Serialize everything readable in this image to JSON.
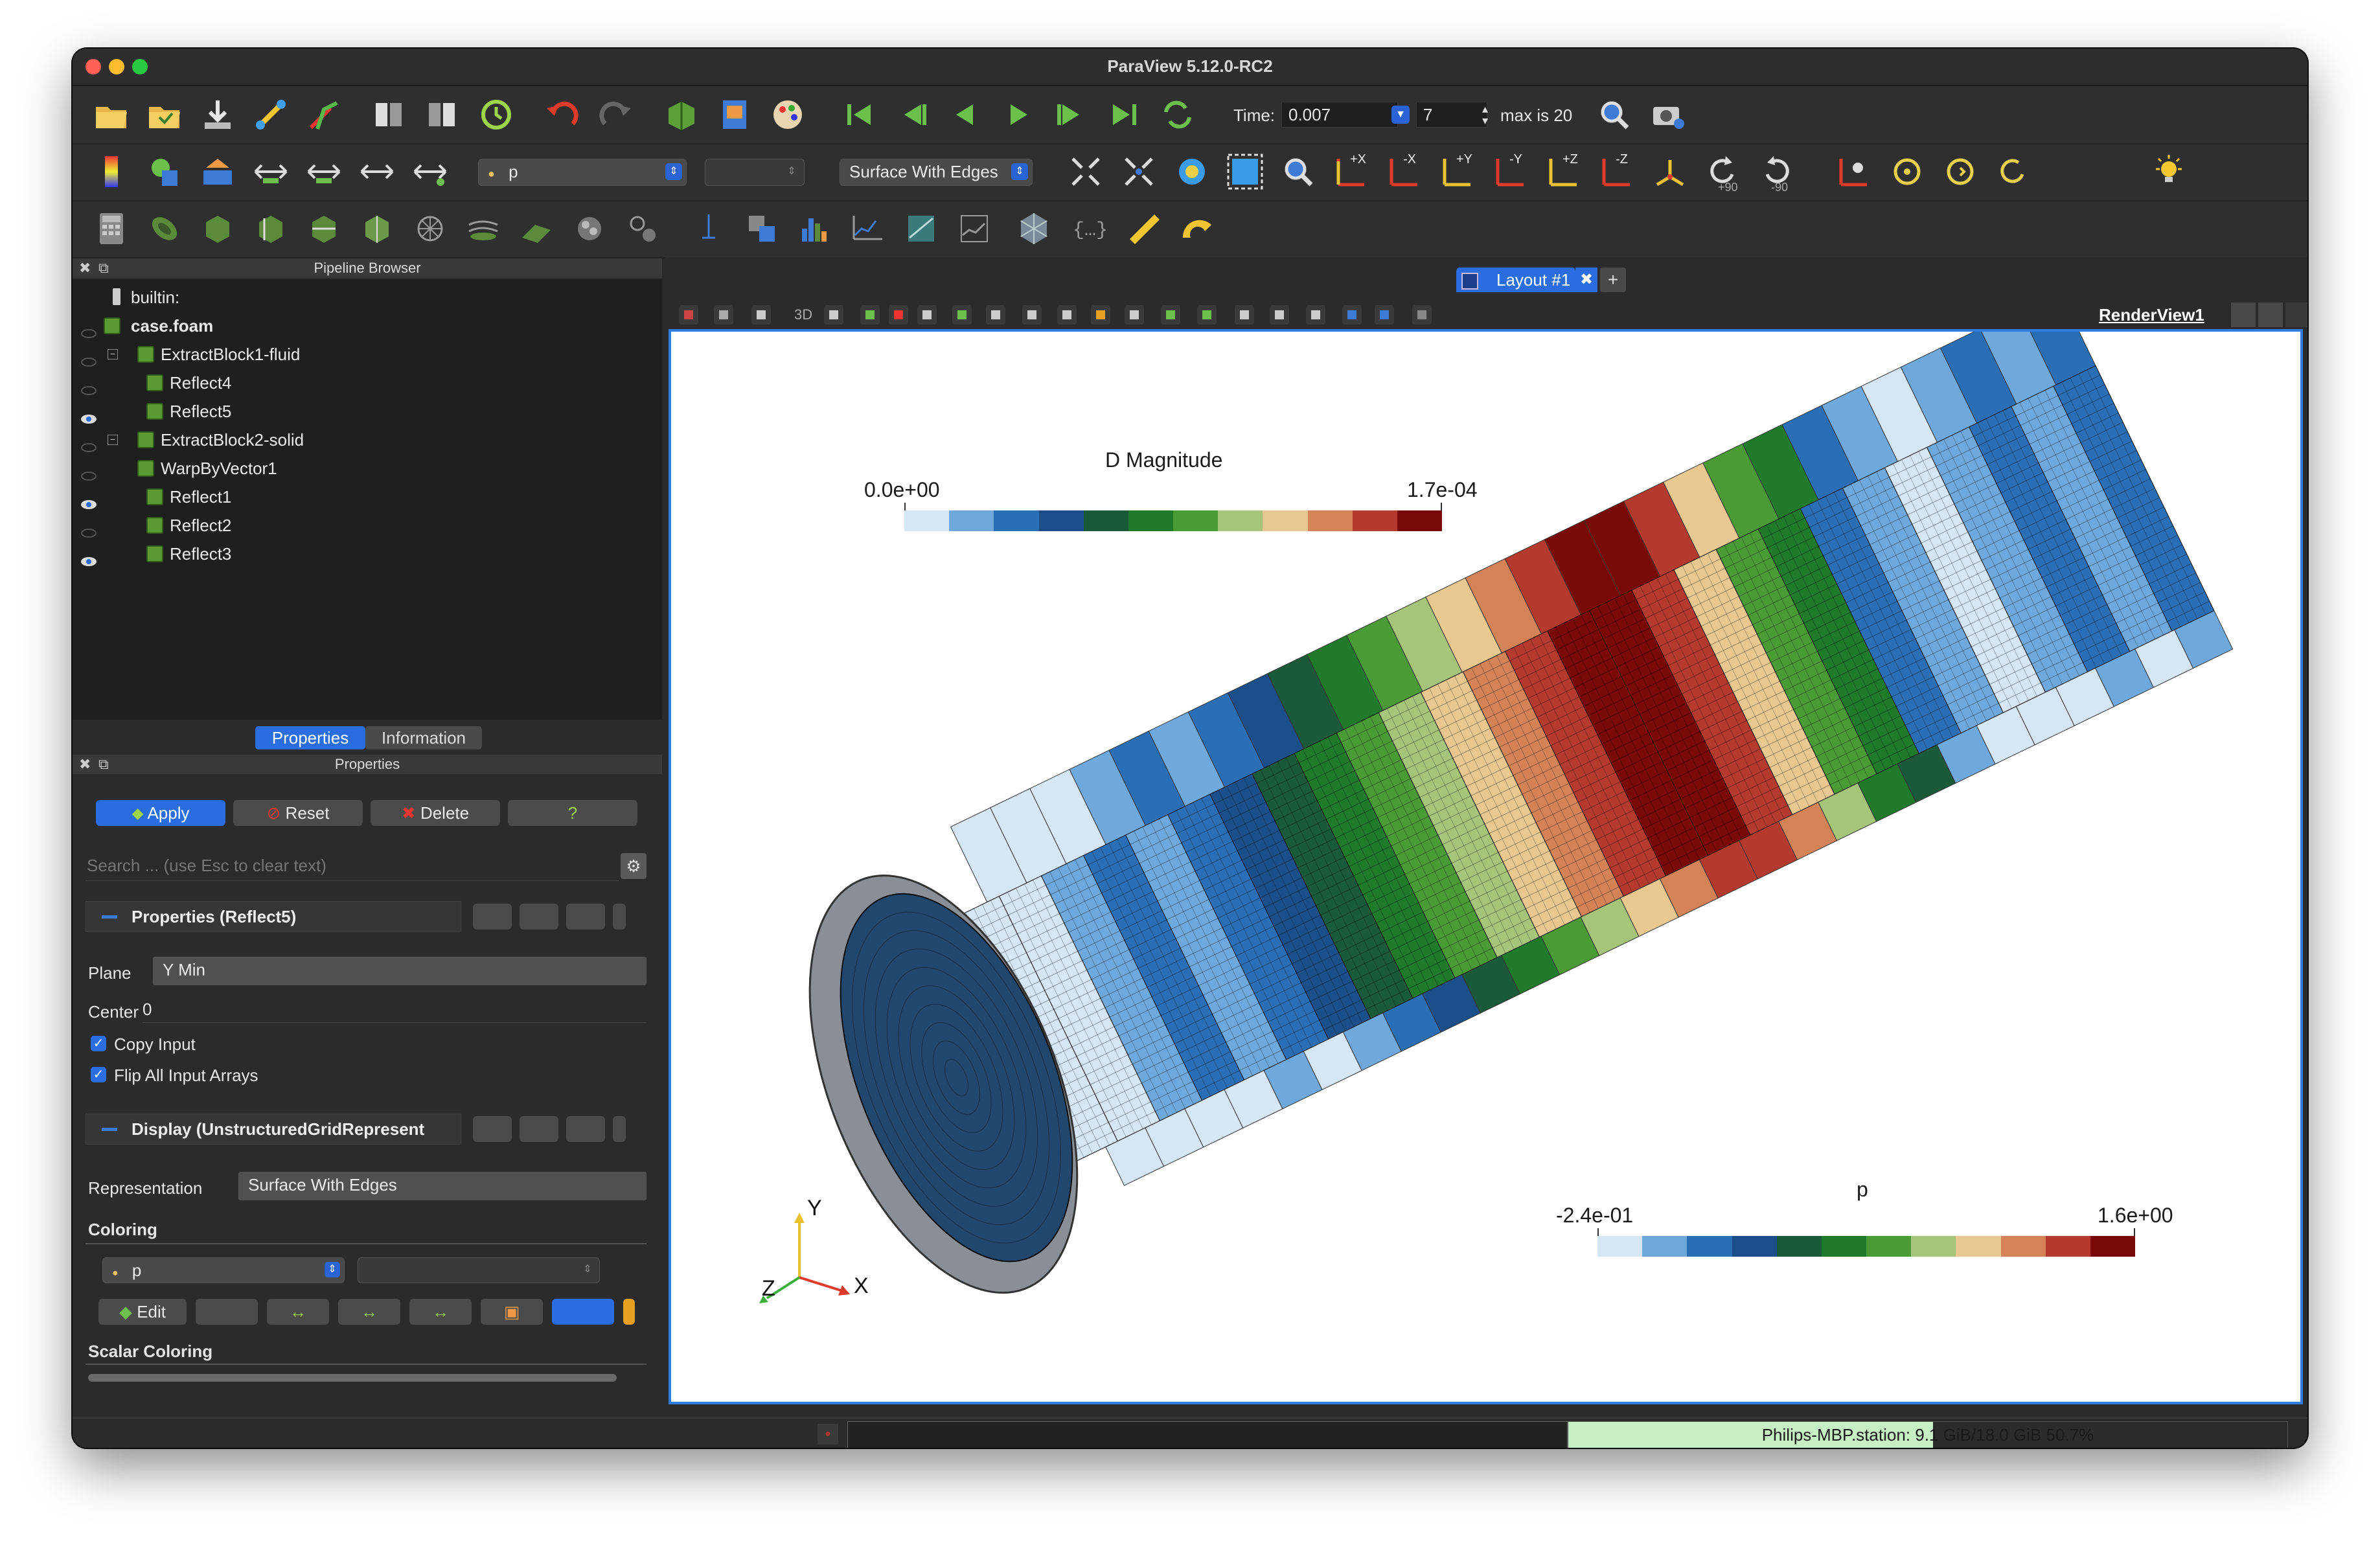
{
  "app": {
    "title": "ParaView 5.12.0-RC2"
  },
  "time_toolbar": {
    "time_label": "Time:",
    "time_value": "0.007",
    "step_value": "7",
    "max_label": "max is 20"
  },
  "color_toolbar": {
    "array_selected": "p",
    "representation": "Surface With Edges",
    "rot_plus": "+90",
    "rot_minus": "-90",
    "axis_px": "+X",
    "axis_mx": "-X",
    "axis_py": "+Y",
    "axis_my": "-Y",
    "axis_pz": "+Z",
    "axis_mz": "-Z"
  },
  "pipeline": {
    "header": "Pipeline Browser",
    "items": [
      {
        "label": "builtin:",
        "bold": false,
        "eye": "none"
      },
      {
        "label": "case.foam",
        "bold": true,
        "eye": "hidden"
      },
      {
        "label": "ExtractBlock1-fluid",
        "bold": false,
        "eye": "hidden"
      },
      {
        "label": "Reflect4",
        "bold": false,
        "eye": "hidden"
      },
      {
        "label": "Reflect5",
        "bold": false,
        "eye": "visible"
      },
      {
        "label": "ExtractBlock2-solid",
        "bold": false,
        "eye": "hidden"
      },
      {
        "label": "WarpByVector1",
        "bold": false,
        "eye": "hidden"
      },
      {
        "label": "Reflect1",
        "bold": false,
        "eye": "visible"
      },
      {
        "label": "Reflect2",
        "bold": false,
        "eye": "hidden"
      },
      {
        "label": "Reflect3",
        "bold": false,
        "eye": "visible"
      }
    ]
  },
  "tabs": {
    "properties": "Properties",
    "information": "Information"
  },
  "properties": {
    "header": "Properties",
    "apply": "Apply",
    "reset": "Reset",
    "delete": "Delete",
    "help": "?",
    "search_placeholder": "Search ... (use Esc to clear text)",
    "section_props": "Properties (Reflect5)",
    "plane_label": "Plane",
    "plane_value": "Y Min",
    "center_label": "Center",
    "center_value": "0",
    "copy_input": "Copy Input",
    "flip_arrays": "Flip All Input Arrays",
    "section_display": "Display (UnstructuredGridRepresent",
    "representation_label": "Representation",
    "representation_value": "Surface With Edges",
    "coloring_label": "Coloring",
    "coloring_array": "p",
    "edit": "Edit",
    "scalar_coloring": "Scalar Coloring"
  },
  "layout": {
    "tab": "Layout #1",
    "plus": "+",
    "renderview": "RenderView1",
    "threed": "3D"
  },
  "colorbar_d": {
    "title": "D Magnitude",
    "min": "0.0e+00",
    "max": "1.7e-04"
  },
  "colorbar_p": {
    "title": "p",
    "min": "-2.4e-01",
    "max": "1.6e+00"
  },
  "axes": {
    "x": "X",
    "y": "Y",
    "z": "Z"
  },
  "palette": [
    "#d6e6f5",
    "#6ea8dc",
    "#2a6fb5",
    "#1c4f8a",
    "#1a5a3a",
    "#1f7a2a",
    "#4a9a36",
    "#a6c47a",
    "#e8c890",
    "#d48358",
    "#b33a2c",
    "#7a0a0a"
  ],
  "status": {
    "memory_text": "Philips-MBP.station: 9.1 GiB/18.0 GiB 50.7%",
    "memory_fraction": 0.507
  }
}
